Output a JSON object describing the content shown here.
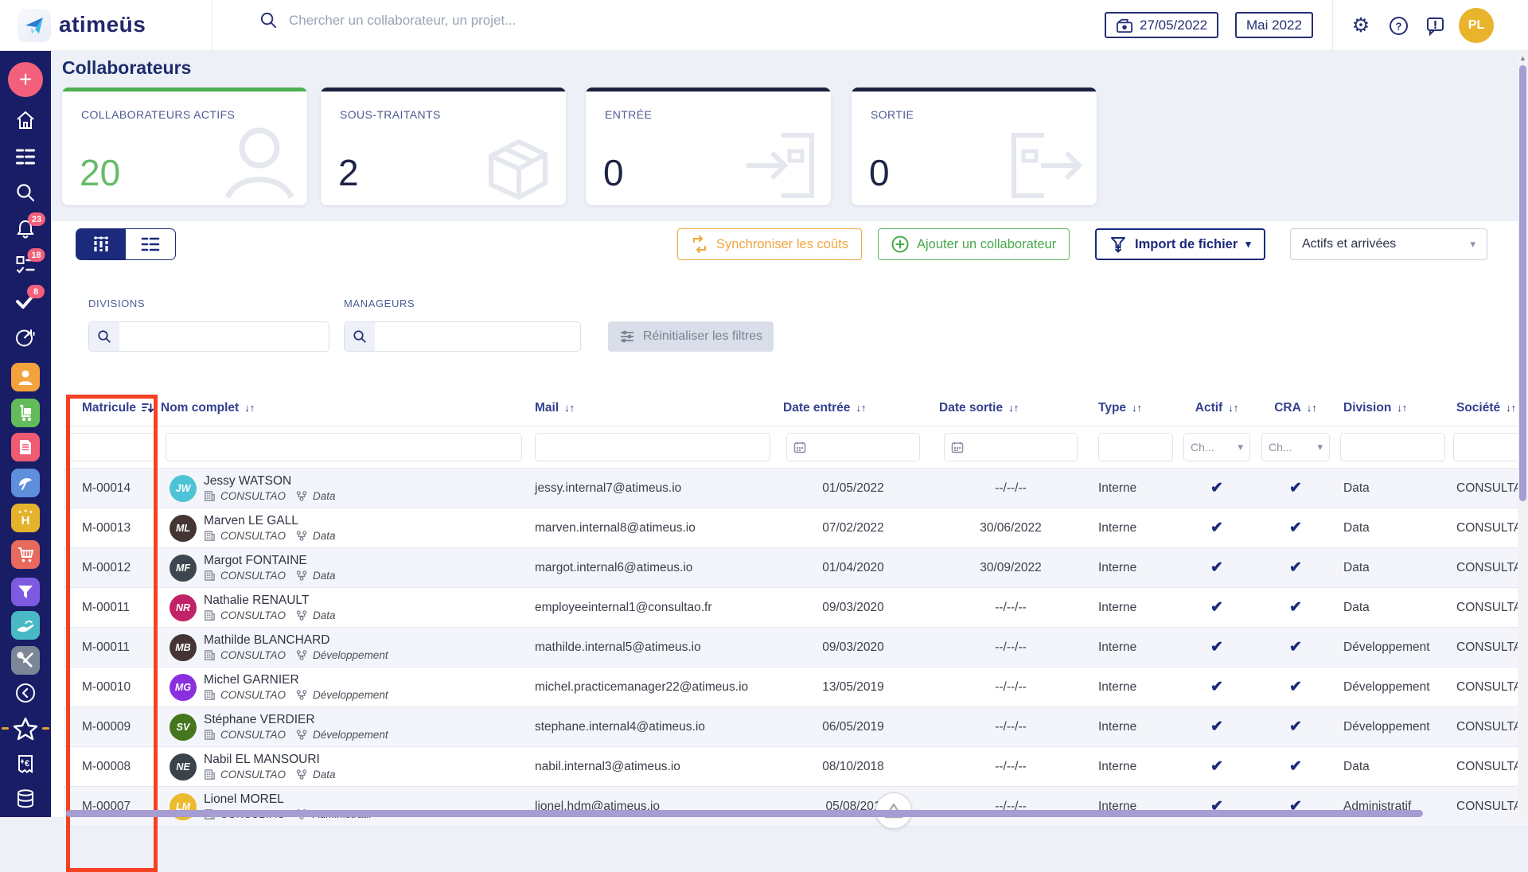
{
  "header": {
    "brand": "atimeüs",
    "search_placeholder": "Chercher un collaborateur, un projet...",
    "date_button": "27/05/2022",
    "month_button": "Mai 2022",
    "avatar_initials": "PL"
  },
  "sidebar": {
    "badges": {
      "notifications": "23",
      "tasks": "18",
      "validations": "8"
    }
  },
  "page": {
    "title": "Collaborateurs",
    "cards": [
      {
        "label": "COLLABORATEURS ACTIFS",
        "value": "20",
        "accent": "#4caf50",
        "value_color": "#66bb6a",
        "icon": "person"
      },
      {
        "label": "SOUS-TRAITANTS",
        "value": "2",
        "accent": "#1b2140",
        "value_color": "#1e2446",
        "icon": "package"
      },
      {
        "label": "ENTRÉE",
        "value": "0",
        "accent": "#1b2140",
        "value_color": "#1e2446",
        "icon": "door-in"
      },
      {
        "label": "SORTIE",
        "value": "0",
        "accent": "#1b2140",
        "value_color": "#1e2446",
        "icon": "door-out"
      }
    ],
    "toolbar": {
      "sync_label": "Synchroniser les coûts",
      "add_label": "Ajouter un collaborateur",
      "import_label": "Import de fichier",
      "scope_select_value": "Actifs et arrivées"
    },
    "filters": {
      "divisions_label": "DIVISIONS",
      "managers_label": "MANAGEURS",
      "reset_label": "Réinitialiser les filtres"
    },
    "table": {
      "columns": [
        "Matricule",
        "Nom complet",
        "Mail",
        "Date entrée",
        "Date sortie",
        "Type",
        "Actif",
        "CRA",
        "Division",
        "Société"
      ],
      "ch_placeholder": "Ch...",
      "rows": [
        {
          "matricule": "M-00014",
          "initials": "JW",
          "avatar_color": "#4ec3d6",
          "name": "Jessy WATSON",
          "company": "CONSULTAO",
          "team": "Data",
          "mail": "jessy.internal7@atimeus.io",
          "date_entree": "01/05/2022",
          "date_sortie": "--/--/--",
          "type": "Interne",
          "division": "Data",
          "societe": "CONSULTAO"
        },
        {
          "matricule": "M-00013",
          "initials": "ML",
          "avatar_color": "#453434",
          "name": "Marven LE GALL",
          "company": "CONSULTAO",
          "team": "Data",
          "mail": "marven.internal8@atimeus.io",
          "date_entree": "07/02/2022",
          "date_sortie": "30/06/2022",
          "type": "Interne",
          "division": "Data",
          "societe": "CONSULTAO"
        },
        {
          "matricule": "M-00012",
          "initials": "MF",
          "avatar_color": "#3e474f",
          "name": "Margot FONTAINE",
          "company": "CONSULTAO",
          "team": "Data",
          "mail": "margot.internal6@atimeus.io",
          "date_entree": "01/04/2020",
          "date_sortie": "30/09/2022",
          "type": "Interne",
          "division": "Data",
          "societe": "CONSULTAO"
        },
        {
          "matricule": "M-00011",
          "initials": "NR",
          "avatar_color": "#c22268",
          "name": "Nathalie RENAULT",
          "company": "CONSULTAO",
          "team": "Data",
          "mail": "employeeinternal1@consultao.fr",
          "date_entree": "09/03/2020",
          "date_sortie": "--/--/--",
          "type": "Interne",
          "division": "Data",
          "societe": "CONSULTAO"
        },
        {
          "matricule": "M-00011",
          "initials": "MB",
          "avatar_color": "#453434",
          "name": "Mathilde BLANCHARD",
          "company": "CONSULTAO",
          "team": "Développement",
          "mail": "mathilde.internal5@atimeus.io",
          "date_entree": "09/03/2020",
          "date_sortie": "--/--/--",
          "type": "Interne",
          "division": "Développement",
          "societe": "CONSULTAO"
        },
        {
          "matricule": "M-00010",
          "initials": "MG",
          "avatar_color": "#8a2fe0",
          "name": "Michel GARNIER",
          "company": "CONSULTAO",
          "team": "Développement",
          "mail": "michel.practicemanager22@atimeus.io",
          "date_entree": "13/05/2019",
          "date_sortie": "--/--/--",
          "type": "Interne",
          "division": "Développement",
          "societe": "CONSULTAO"
        },
        {
          "matricule": "M-00009",
          "initials": "SV",
          "avatar_color": "#44761d",
          "name": "Stéphane VERDIER",
          "company": "CONSULTAO",
          "team": "Développement",
          "mail": "stephane.internal4@atimeus.io",
          "date_entree": "06/05/2019",
          "date_sortie": "--/--/--",
          "type": "Interne",
          "division": "Développement",
          "societe": "CONSULTAO"
        },
        {
          "matricule": "M-00008",
          "initials": "NE",
          "avatar_color": "#3a424a",
          "name": "Nabil EL MANSOURI",
          "company": "CONSULTAO",
          "team": "Data",
          "mail": "nabil.internal3@atimeus.io",
          "date_entree": "08/10/2018",
          "date_sortie": "--/--/--",
          "type": "Interne",
          "division": "Data",
          "societe": "CONSULTAO"
        },
        {
          "matricule": "M-00007",
          "initials": "LM",
          "avatar_color": "#ecba2f",
          "name": "Lionel MOREL",
          "company": "CONSULTAO",
          "team": "Administratif",
          "mail": "lionel.hdm@atimeus.io",
          "date_entree": "05/08/201",
          "date_sortie": "--/--/--",
          "type": "Interne",
          "division": "Administratif",
          "societe": "CONSULTAO"
        }
      ]
    }
  },
  "colors": {
    "annotation_red": "#f54123",
    "scrollbar_purple": "#a69dd2",
    "sidebar_navy": "#191d66",
    "brand_navy": "#1b2a7a"
  }
}
